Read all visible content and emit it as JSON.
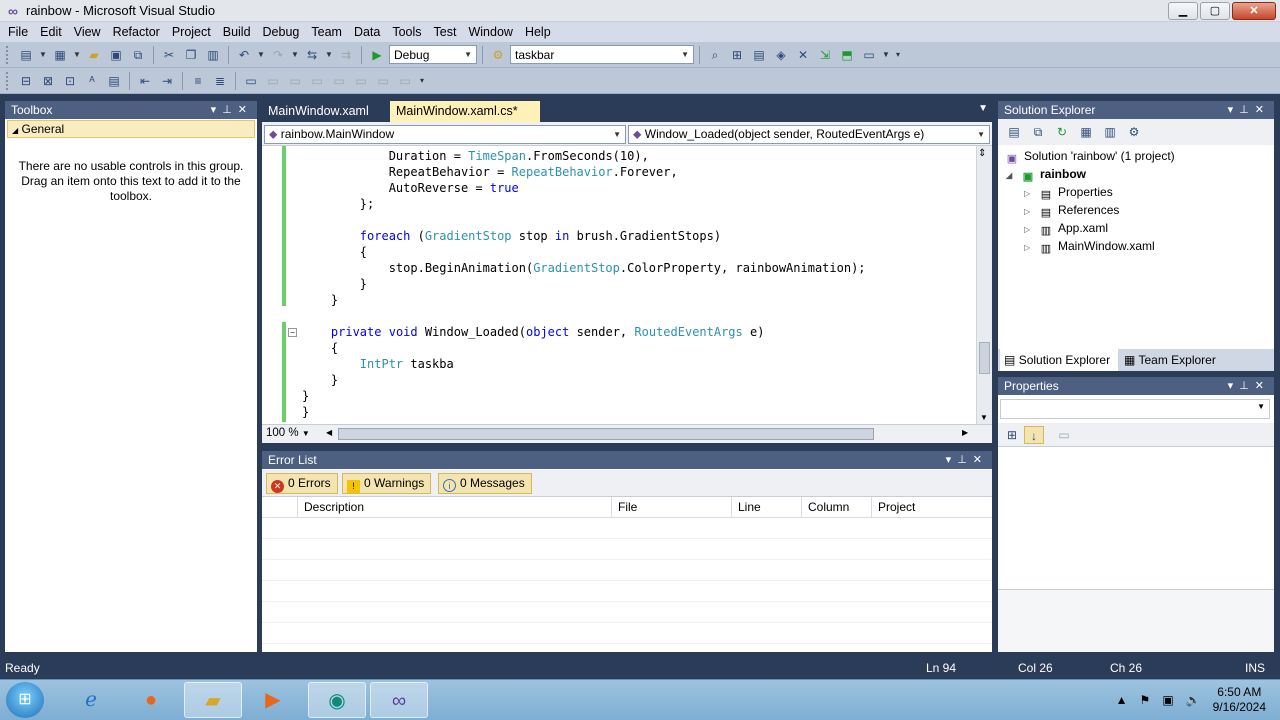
{
  "window": {
    "title": "rainbow - Microsoft Visual Studio",
    "minimize": "▁",
    "maximize": "▢",
    "close": "✕"
  },
  "menu": [
    "File",
    "Edit",
    "View",
    "Refactor",
    "Project",
    "Build",
    "Debug",
    "Team",
    "Data",
    "Tools",
    "Test",
    "Window",
    "Help"
  ],
  "toolbar": {
    "config": "Debug",
    "find_value": "taskbar"
  },
  "toolbox": {
    "title": "Toolbox",
    "group": "General",
    "empty_msg": "There are no usable controls in this group. Drag an item onto this text to add it to the toolbox."
  },
  "doc_tabs": [
    {
      "label": "MainWindow.xaml"
    },
    {
      "label": "MainWindow.xaml.cs*",
      "close": "✕"
    }
  ],
  "nav": {
    "type_combo": "rainbow.MainWindow",
    "member_combo": "Window_Loaded(object sender, RoutedEventArgs e)"
  },
  "code_lines": [
    [
      [
        "",
        "            Duration = "
      ],
      [
        "ty",
        "TimeSpan"
      ],
      [
        "",
        ".FromSeconds(10),"
      ]
    ],
    [
      [
        "",
        "            RepeatBehavior = "
      ],
      [
        "ty",
        "RepeatBehavior"
      ],
      [
        "",
        ".Forever,"
      ]
    ],
    [
      [
        "",
        "            AutoReverse = "
      ],
      [
        "kw",
        "true"
      ]
    ],
    [
      [
        "",
        "        };"
      ]
    ],
    [
      [
        "",
        ""
      ]
    ],
    [
      [
        "kw",
        "        foreach"
      ],
      [
        "",
        " ("
      ],
      [
        "ty",
        "GradientStop"
      ],
      [
        "",
        " stop "
      ],
      [
        "kw",
        "in"
      ],
      [
        "",
        " brush.GradientStops)"
      ]
    ],
    [
      [
        "",
        "        {"
      ]
    ],
    [
      [
        "",
        "            stop.BeginAnimation("
      ],
      [
        "ty",
        "GradientStop"
      ],
      [
        "",
        ".ColorProperty, rainbowAnimation);"
      ]
    ],
    [
      [
        "",
        "        }"
      ]
    ],
    [
      [
        "",
        "    }"
      ]
    ],
    [
      [
        "",
        ""
      ]
    ],
    [
      [
        "kw",
        "    private"
      ],
      [
        "",
        " "
      ],
      [
        "kw",
        "void"
      ],
      [
        "",
        " Window_Loaded("
      ],
      [
        "kw",
        "object"
      ],
      [
        "",
        " sender, "
      ],
      [
        "ty",
        "RoutedEventArgs"
      ],
      [
        "",
        " e)"
      ]
    ],
    [
      [
        "",
        "    {"
      ]
    ],
    [
      [
        "ty",
        "        IntPtr"
      ],
      [
        "",
        " taskba"
      ]
    ],
    [
      [
        "",
        "    }"
      ]
    ],
    [
      [
        "",
        "}"
      ]
    ],
    [
      [
        "",
        "}"
      ]
    ]
  ],
  "editor": {
    "zoom": "100 %"
  },
  "error_list": {
    "title": "Error List",
    "errors": "0 Errors",
    "warnings": "0 Warnings",
    "messages": "0 Messages",
    "columns": [
      "Description",
      "File",
      "Line",
      "Column",
      "Project"
    ]
  },
  "solution_explorer": {
    "title": "Solution Explorer",
    "solution": "Solution 'rainbow' (1 project)",
    "project": "rainbow",
    "items": [
      "Properties",
      "References",
      "App.xaml",
      "MainWindow.xaml"
    ],
    "tabs": [
      "Solution Explorer",
      "Team Explorer"
    ]
  },
  "properties": {
    "title": "Properties"
  },
  "status": {
    "state": "Ready",
    "ln": "Ln 94",
    "col": "Col 26",
    "ch": "Ch 26",
    "mode": "INS"
  },
  "taskbar": {
    "time": "6:50 AM",
    "date": "9/16/2024"
  },
  "colors": {
    "accent": "#4d6082",
    "keyword": "#0000ff",
    "type": "#2b91af",
    "tab_active": "#fff1b8"
  }
}
